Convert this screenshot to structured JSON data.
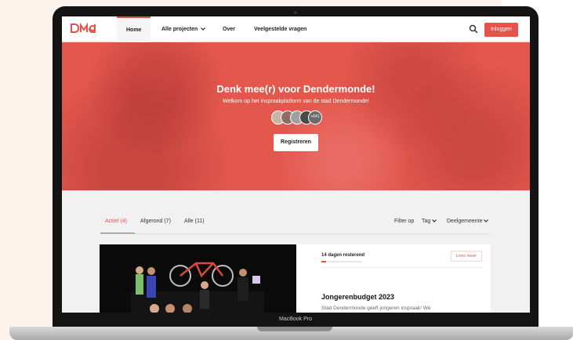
{
  "colors": {
    "accent": "#e5534b",
    "hero_bg": "#e4574d",
    "laptop": "#141414"
  },
  "brand": {
    "logo_text": "DMd"
  },
  "nav": {
    "items": [
      {
        "label": "Home",
        "active": true
      },
      {
        "label": "Alle projecten",
        "dropdown": true
      },
      {
        "label": "Over"
      },
      {
        "label": "Veelgestelde vragen"
      }
    ],
    "search_icon": "search-icon",
    "login_label": "Inloggen"
  },
  "hero": {
    "title": "Denk mee(r) voor Dendermonde!",
    "subtitle": "Welkom op het inspraakplatform van de stad Dendermonde!",
    "participants_count": "+641",
    "register_label": "Registreren"
  },
  "filters": {
    "tabs": [
      {
        "label": "Actief (4)",
        "active": true
      },
      {
        "label": "Afgerond (7)"
      },
      {
        "label": "Alle (11)"
      }
    ],
    "filter_label": "Filter op",
    "tag_label": "Tag",
    "municipality_label": "Deelgemeente"
  },
  "project_card": {
    "days_remaining": "14 dagen resterend",
    "progress_fraction": 0.12,
    "more_label": "Lees meer",
    "title": "Jongerenbudget 2023",
    "description": "Stad Dendermonde geeft jongeren inspraak! We"
  },
  "device_label": "MacBook Pro"
}
